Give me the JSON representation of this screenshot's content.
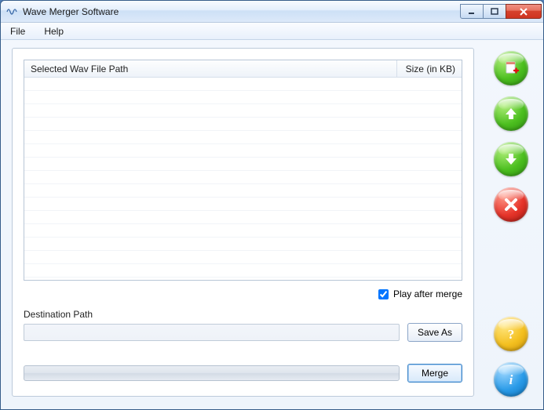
{
  "window": {
    "title": "Wave Merger Software"
  },
  "menu": {
    "file": "File",
    "help": "Help"
  },
  "list": {
    "col_path": "Selected Wav File Path",
    "col_size": "Size (in KB)"
  },
  "play_after_label": "Play after merge",
  "play_after_checked": true,
  "destination_label": "Destination Path",
  "destination_value": "",
  "buttons": {
    "save_as": "Save As",
    "merge": "Merge"
  },
  "side": {
    "add": "add-file",
    "up": "move-up",
    "down": "move-down",
    "remove": "remove",
    "help": "help",
    "info": "info"
  }
}
